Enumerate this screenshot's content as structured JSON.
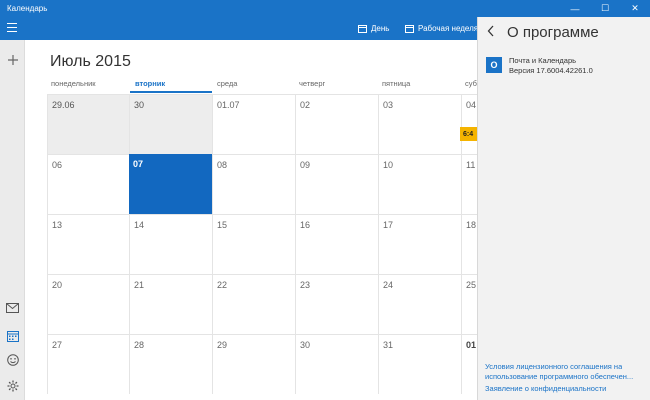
{
  "window": {
    "title": "Календарь",
    "controls": {
      "minimize": "—",
      "maximize": "☐",
      "close": "✕"
    }
  },
  "toolbar": {
    "day_label": "День",
    "workweek_label": "Рабочая неделя"
  },
  "calendar": {
    "month_title": "Июль 2015",
    "weekdays": [
      "понедельник",
      "вторник",
      "среда",
      "четверг",
      "пятница",
      "суббота"
    ],
    "weekday_visible": [
      "понедельник",
      "вторник",
      "среда",
      "четверг",
      "пятница",
      "суб"
    ],
    "weeks": [
      [
        "29.06",
        "30",
        "01.07",
        "02",
        "03",
        "04"
      ],
      [
        "06",
        "07",
        "08",
        "09",
        "10",
        "11"
      ],
      [
        "13",
        "14",
        "15",
        "16",
        "17",
        "18"
      ],
      [
        "20",
        "21",
        "22",
        "23",
        "24",
        "25"
      ],
      [
        "27",
        "28",
        "29",
        "30",
        "31",
        "01"
      ]
    ],
    "today": "07",
    "event_chip": "6:4"
  },
  "sidebar": {
    "icons": [
      "add-icon",
      "mail-icon",
      "calendar-icon",
      "smiley-icon",
      "gear-icon"
    ]
  },
  "about_panel": {
    "title": "О программе",
    "app_name": "Почта и Календарь",
    "version": "Версия 17.6004.42261.0",
    "link_license_line1": "Условия лицензионного соглашения на",
    "link_license_line2": "использование программного обеспечен...",
    "link_privacy": "Заявление о конфиденциальности"
  },
  "colors": {
    "accent": "#1a73c7",
    "today_cell": "#1268c0",
    "event": "#f5b400"
  }
}
